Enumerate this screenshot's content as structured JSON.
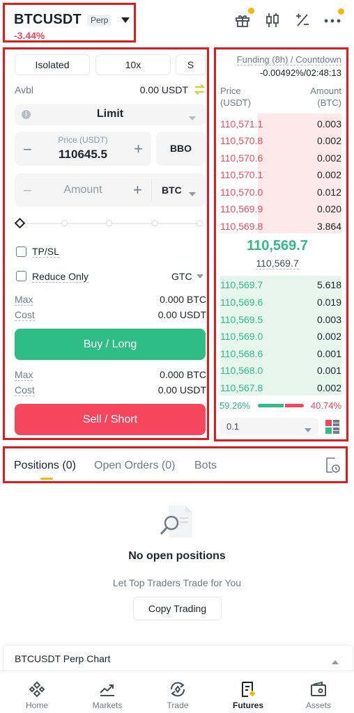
{
  "header": {
    "symbol": "BTCUSDT",
    "tag": "Perp",
    "change": "-3.44%"
  },
  "form": {
    "margin_mode": "Isolated",
    "leverage": "10x",
    "asset_mode": "S",
    "avbl_label": "Avbl",
    "avbl_value": "0.00 USDT",
    "order_type": "Limit",
    "price_label": "Price (USDT)",
    "price_value": "110645.5",
    "bbo_label": "BBO",
    "amount_placeholder": "Amount",
    "amount_unit": "BTC",
    "tpsl_label": "TP/SL",
    "reduce_only_label": "Reduce Only",
    "tif": "GTC",
    "buy": {
      "max_label": "Max",
      "max_value": "0.000 BTC",
      "cost_label": "Cost",
      "cost_value": "0.00 USDT",
      "button": "Buy / Long"
    },
    "sell": {
      "max_label": "Max",
      "max_value": "0.000 BTC",
      "cost_label": "Cost",
      "cost_value": "0.00 USDT",
      "button": "Sell / Short"
    }
  },
  "orderbook": {
    "funding_label": "Funding (8h) / Countdown",
    "funding_value": "-0.00492%/02:48:13",
    "col_price": "Price",
    "col_price_unit": "(USDT)",
    "col_amount": "Amount",
    "col_amount_unit": "(BTC)",
    "asks": [
      {
        "price": "110,571.1",
        "amount": "0.003"
      },
      {
        "price": "110,570.8",
        "amount": "0.002"
      },
      {
        "price": "110,570.6",
        "amount": "0.002"
      },
      {
        "price": "110,570.1",
        "amount": "0.002"
      },
      {
        "price": "110,570.0",
        "amount": "0.012"
      },
      {
        "price": "110,569.9",
        "amount": "0.020"
      },
      {
        "price": "110,569.8",
        "amount": "3.864"
      }
    ],
    "last_price": "110,569.7",
    "mark_price": "110,569.7",
    "bids": [
      {
        "price": "110,569.7",
        "amount": "5.618"
      },
      {
        "price": "110,569.6",
        "amount": "0.019"
      },
      {
        "price": "110,569.5",
        "amount": "0.003"
      },
      {
        "price": "110,569.0",
        "amount": "0.002"
      },
      {
        "price": "110,568.6",
        "amount": "0.001"
      },
      {
        "price": "110,568.0",
        "amount": "0.001"
      },
      {
        "price": "110,567.8",
        "amount": "0.002"
      }
    ],
    "buy_ratio": "59.26%",
    "sell_ratio": "40.74%",
    "buy_ratio_value": 0.5926,
    "precision": "0.1"
  },
  "tabs": {
    "positions": "Positions (0)",
    "open_orders": "Open Orders (0)",
    "bots": "Bots"
  },
  "empty": {
    "title": "No open positions",
    "subtitle": "Let Top Traders Trade for You",
    "button": "Copy Trading"
  },
  "chart_bar": {
    "label": "BTCUSDT Perp Chart"
  },
  "nav": {
    "home": "Home",
    "markets": "Markets",
    "trade": "Trade",
    "futures": "Futures",
    "assets": "Assets"
  },
  "colors": {
    "buy": "#2ebd85",
    "sell": "#f6465d",
    "highlight": "#e01b1b",
    "accent": "#f0b90b"
  }
}
